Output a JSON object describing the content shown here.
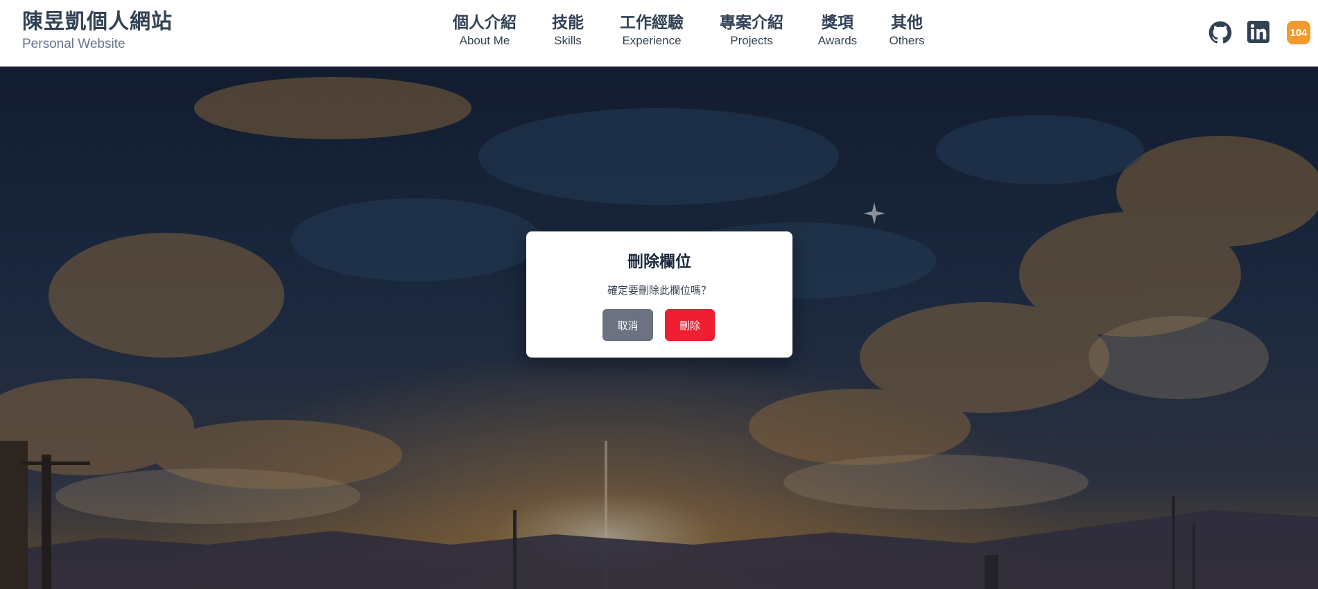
{
  "brand": {
    "title": "陳昱凱個人網站",
    "subtitle": "Personal Website"
  },
  "nav": [
    {
      "zh": "個人介紹",
      "en": "About Me"
    },
    {
      "zh": "技能",
      "en": "Skills"
    },
    {
      "zh": "工作經驗",
      "en": "Experience"
    },
    {
      "zh": "專案介紹",
      "en": "Projects"
    },
    {
      "zh": "獎項",
      "en": "Awards"
    },
    {
      "zh": "其他",
      "en": "Others"
    }
  ],
  "social": {
    "github_icon": "github-icon",
    "linkedin_icon": "linkedin-icon",
    "job_bank_label": "104"
  },
  "modal": {
    "title": "刪除欄位",
    "message": "確定要刪除此欄位嗎？",
    "cancel_label": "取消",
    "delete_label": "刪除"
  },
  "colors": {
    "header_bg": "#ffffff",
    "text_primary": "#334155",
    "cancel_button": "#6b7280",
    "delete_button": "#ef1f31",
    "badge_104": "#f39a2c"
  }
}
